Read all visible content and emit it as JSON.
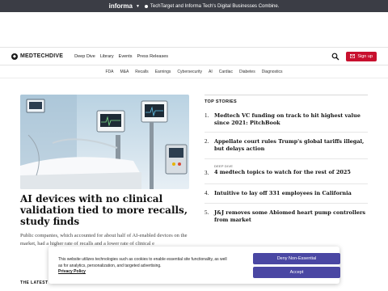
{
  "informa_bar": {
    "brand": "informa",
    "notice": "TechTarget and Informa Tech's Digital Businesses Combine."
  },
  "header": {
    "logo_text": "MEDTECHDIVE",
    "nav": [
      "Deep Dive",
      "Library",
      "Events",
      "Press Releases"
    ],
    "signup_label": "Sign up"
  },
  "subnav": [
    "FDA",
    "M&A",
    "Recalls",
    "Earnings",
    "Cybersecurity",
    "AI",
    "Cardiac",
    "Diabetes",
    "Diagnostics"
  ],
  "feature": {
    "headline": "AI devices with no clinical validation tied to more recalls, study finds",
    "dek": "Public companies, which accounted for about half of AI-enabled devices on the market, had a higher rate of recalls and a lower rate of clinical e"
  },
  "latest_label": "THE LATEST",
  "top_stories": {
    "label": "TOP STORIES",
    "items": [
      {
        "num": "1.",
        "kicker": "",
        "title": "Medtech VC funding on track to hit highest value since 2021: PitchBook"
      },
      {
        "num": "2.",
        "kicker": "",
        "title": "Appellate court rules Trump's global tariffs illegal, but delays action"
      },
      {
        "num": "3.",
        "kicker": "DEEP DIVE",
        "title": "4 medtech topics to watch for the rest of 2025"
      },
      {
        "num": "4.",
        "kicker": "",
        "title": "Intuitive to lay off 331 employees in California"
      },
      {
        "num": "5.",
        "kicker": "",
        "title": "J&J removes some Abiomed heart pump controllers from market"
      }
    ]
  },
  "cookie": {
    "text": "This website utilizes technologies such as cookies to enable essential site functionality, as well as for analytics, personalization, and targeted advertising.",
    "privacy_link": "Privacy Policy",
    "deny_label": "Deny Non-Essential",
    "accept_label": "Accept"
  },
  "colors": {
    "accent": "#c8102e",
    "button": "#4a47a3",
    "informa_bar": "#3b3d45"
  }
}
